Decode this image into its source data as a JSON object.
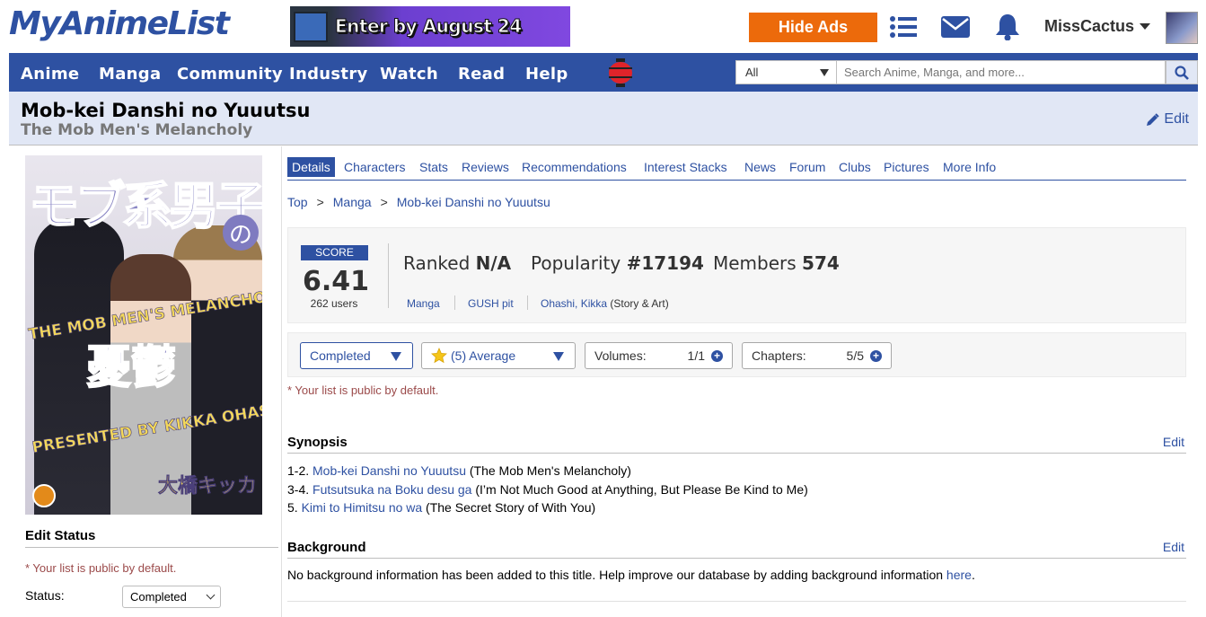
{
  "header": {
    "logo": "MyAnimeList",
    "banner_text": "Enter by August 24",
    "hide_ads": "Hide Ads",
    "username": "MissCactus"
  },
  "nav": {
    "items": [
      "Anime",
      "Manga",
      "Community",
      "Industry",
      "Watch",
      "Read",
      "Help"
    ],
    "search_category": "All",
    "search_placeholder": "Search Anime, Manga, and more..."
  },
  "title": {
    "main": "Mob-kei Danshi no Yuuutsu",
    "english": "The Mob Men's Melancholy",
    "edit": "Edit"
  },
  "cover": {
    "kanji_top": "モブ系男子",
    "no": "の",
    "english_top": "THE MOB MEN'S MELANCHOLY",
    "kanji_mid": "憂鬱",
    "presented": "PRESENTED BY KIKKA OHASHI",
    "author_jp": "大橋キッカ"
  },
  "left": {
    "edit_status_title": "Edit Status",
    "public_note": "* Your list is public by default.",
    "status_label": "Status:",
    "status_value": "Completed"
  },
  "tabs": [
    "Details",
    "Characters",
    "Stats",
    "Reviews",
    "Recommendations",
    "Interest Stacks",
    "News",
    "Forum",
    "Clubs",
    "Pictures",
    "More Info"
  ],
  "breadcrumb": [
    "Top",
    "Manga",
    "Mob-kei Danshi no Yuuutsu"
  ],
  "breadcrumb_sep": ">",
  "score": {
    "label": "SCORE",
    "value": "6.41",
    "users": "262 users",
    "ranked_label": "Ranked",
    "ranked_value": "N/A",
    "popularity_label": "Popularity",
    "popularity_value": "#17194",
    "members_label": "Members",
    "members_value": "574",
    "type": "Manga",
    "magazine": "GUSH pit",
    "author": "Ohashi, Kikka",
    "author_role": "(Story & Art)"
  },
  "list": {
    "status": "Completed",
    "rating": "(5) Average",
    "volumes_label": "Volumes:",
    "volumes_value": "1/1",
    "chapters_label": "Chapters:",
    "chapters_value": "5/5",
    "public_note": "* Your list is public by default."
  },
  "synopsis": {
    "title": "Synopsis",
    "edit": "Edit",
    "lines": [
      {
        "prefix": "1-2. ",
        "link": "Mob-kei Danshi no Yuuutsu",
        "suffix": " (The Mob Men's Melancholy)"
      },
      {
        "prefix": "3-4. ",
        "link": "Futsutsuka na Boku desu ga",
        "suffix": " (I’m Not Much Good at Anything, But Please Be Kind to Me)"
      },
      {
        "prefix": "5. ",
        "link": "Kimi to Himitsu no wa",
        "suffix": " (The Secret Story of With You)"
      }
    ]
  },
  "background": {
    "title": "Background",
    "edit": "Edit",
    "text": "No background information has been added to this title. Help improve our database by adding background information ",
    "link": "here",
    "end": "."
  },
  "colors": {
    "brand_blue": "#2e51a2",
    "light_blue": "#e1e7f5",
    "orange": "#ec6a0b"
  }
}
